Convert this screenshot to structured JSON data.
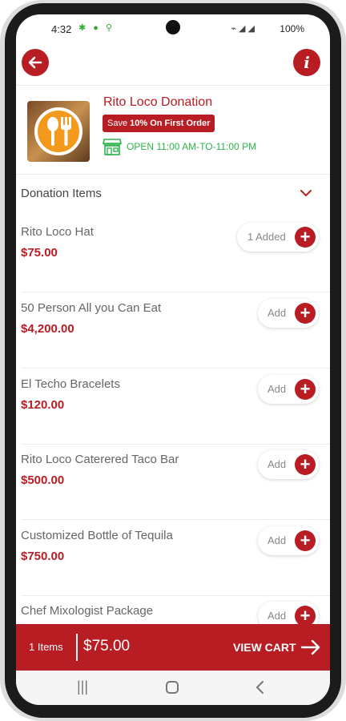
{
  "status_bar": {
    "time": "4:32",
    "battery": "100%"
  },
  "store": {
    "name": "Rito Loco Donation",
    "promo_prefix": "Save",
    "promo_bold": "10% On First Order",
    "open_hours": "OPEN 11:00 AM-TO-11:00 PM"
  },
  "section": {
    "title": "Donation Items"
  },
  "items": [
    {
      "name": "Rito Loco  Hat",
      "price": "$75.00",
      "button": "1 Added"
    },
    {
      "name": "50 Person All you Can Eat",
      "price": "$4,200.00",
      "button": "Add"
    },
    {
      "name": "El Techo Bracelets",
      "price": "$120.00",
      "button": "Add"
    },
    {
      "name": "Rito Loco Caterered Taco Bar",
      "price": "$500.00",
      "button": "Add"
    },
    {
      "name": "Customized Bottle of Tequila",
      "price": "$750.00",
      "button": "Add"
    },
    {
      "name": "Chef Mixologist Package",
      "price": "",
      "button": "Add"
    }
  ],
  "cart": {
    "count": "1 Items",
    "total": "$75.00",
    "action": "VIEW CART"
  },
  "colors": {
    "brand": "#b81d23",
    "open_green": "#2db34a"
  }
}
